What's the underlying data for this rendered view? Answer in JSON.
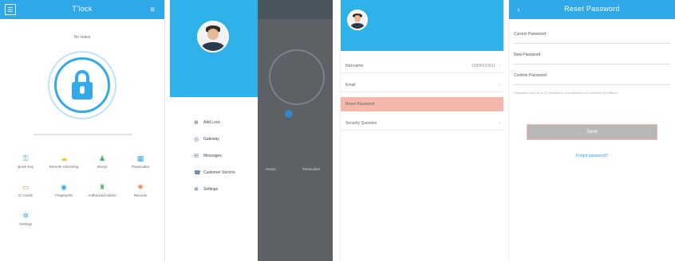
{
  "colors": {
    "primary": "#2fa8ea",
    "highlight": "#f4b7a9",
    "overlay": "#5d6166"
  },
  "screen1": {
    "title": "Tʼlock",
    "status": "No status",
    "grid": [
      {
        "label": "Quick Key",
        "icon": "key-icon"
      },
      {
        "label": "Remote Unlocking",
        "icon": "cloud-unlock-icon"
      },
      {
        "label": "eKeys",
        "icon": "person-key-icon"
      },
      {
        "label": "Passcodes",
        "icon": "keypad-icon"
      },
      {
        "label": "IC Cards",
        "icon": "card-icon"
      },
      {
        "label": "Fingerprint",
        "icon": "fingerprint-icon"
      },
      {
        "label": "Authorized Admin",
        "icon": "admin-icon"
      },
      {
        "label": "Records",
        "icon": "records-icon"
      },
      {
        "label": "Settings",
        "icon": "gear-icon"
      }
    ]
  },
  "screen2": {
    "menu": [
      {
        "label": "Add Lock",
        "icon": "plus-icon"
      },
      {
        "label": "Gateway",
        "icon": "gateway-icon"
      },
      {
        "label": "Messages",
        "icon": "message-icon"
      },
      {
        "label": "Customer Service",
        "icon": "service-icon"
      },
      {
        "label": "Settings",
        "icon": "gear-icon"
      }
    ],
    "shaded_labels": [
      "eKeys",
      "Passcodes"
    ]
  },
  "screen3": {
    "rows": [
      {
        "label": "Nickname",
        "value": "13896523811"
      },
      {
        "label": "Email",
        "value": ""
      },
      {
        "label": "Reset Password",
        "value": ""
      },
      {
        "label": "Security Question",
        "value": ""
      }
    ]
  },
  "screen4": {
    "title": "Reset Password",
    "fields": [
      "Current Password",
      "New Password",
      "Confirm Password"
    ],
    "hint": "Password must be 6-20 characters, a combination of numbers and letters.",
    "button": "Save",
    "link": "Forgot password?"
  }
}
